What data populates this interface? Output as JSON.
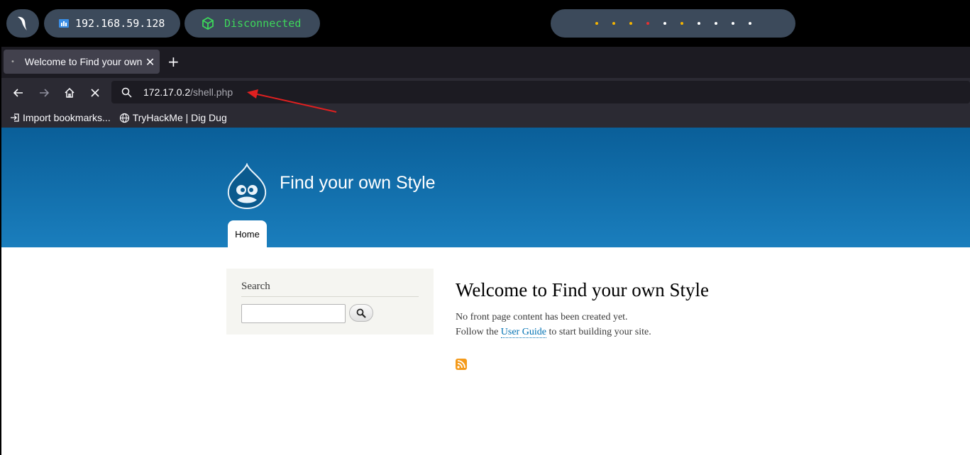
{
  "system_bar": {
    "ip_address": "192.168.59.128",
    "vpn_status": "Disconnected",
    "status_dot_colors": [
      "#f5b400",
      "#f5b400",
      "#f5b400",
      "#e83030",
      "#ffffff",
      "#f5b400",
      "#ffffff",
      "#ffffff",
      "#ffffff",
      "#ffffff"
    ]
  },
  "browser": {
    "tab_title": "Welcome to Find your own Style",
    "url_host": "172.17.0.2",
    "url_path": "/shell.php",
    "bookmarks": [
      {
        "label": "Import bookmarks..."
      },
      {
        "label": "TryHackMe | Dig Dug"
      }
    ]
  },
  "site": {
    "name": "Find your own Style",
    "nav_home": "Home",
    "sidebar_search_heading": "Search",
    "main_title": "Welcome to Find your own Style",
    "para1": "No front page content has been created yet.",
    "para2_prefix": "Follow the ",
    "para2_link": "User Guide",
    "para2_suffix": " to start building your site.",
    "header_color_top": "#0a5f99",
    "header_color_bottom": "#1a7ebd",
    "link_color": "#0071b3"
  }
}
